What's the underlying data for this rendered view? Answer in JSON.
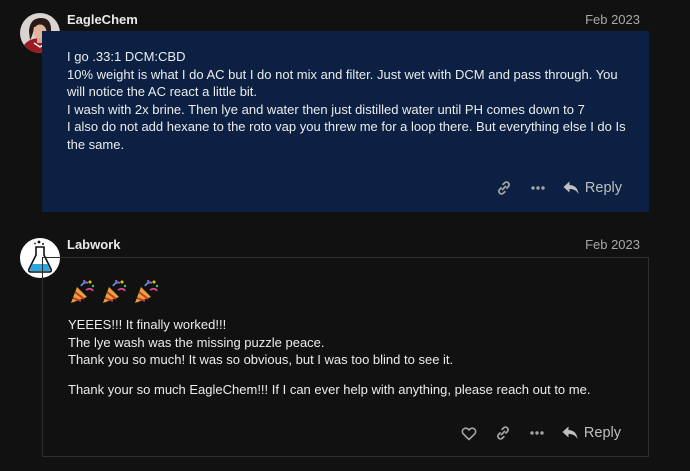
{
  "posts": [
    {
      "username": "EagleChem",
      "date": "Feb 2023",
      "lines": [
        "I go .33:1 DCM:CBD",
        "10% weight is what I do AC but I do not mix and filter. Just wet with DCM and pass through. You will notice the AC react a little bit.",
        "I wash with 2x brine. Then lye and water then just distilled water until PH comes down to 7",
        "I also do not add hexane to the roto vap you threw me for a loop there. But everything else I do Is the same."
      ],
      "actions": {
        "link_icon": "link-icon",
        "more_icon": "ellipsis-icon",
        "reply_label": "Reply"
      }
    },
    {
      "username": "Labwork",
      "date": "Feb 2023",
      "emoji": [
        "party-popper",
        "party-popper",
        "party-popper"
      ],
      "paragraph1": [
        "YEEES!!! It finally worked!!!",
        "The lye wash was the missing puzzle peace.",
        "Thank you so much! It was so obvious, but I was too blind to see it."
      ],
      "paragraph2": "Thank your so much EagleChem!!! If I can ever help with anything, please reach out to me.",
      "actions": {
        "like_icon": "heart-icon",
        "link_icon": "link-icon",
        "more_icon": "ellipsis-icon",
        "reply_label": "Reply"
      }
    }
  ],
  "colors": {
    "page_background": "#111111",
    "highlighted_post_background": "#0b2042",
    "text": "#ececec",
    "muted": "#a8a8a8"
  }
}
